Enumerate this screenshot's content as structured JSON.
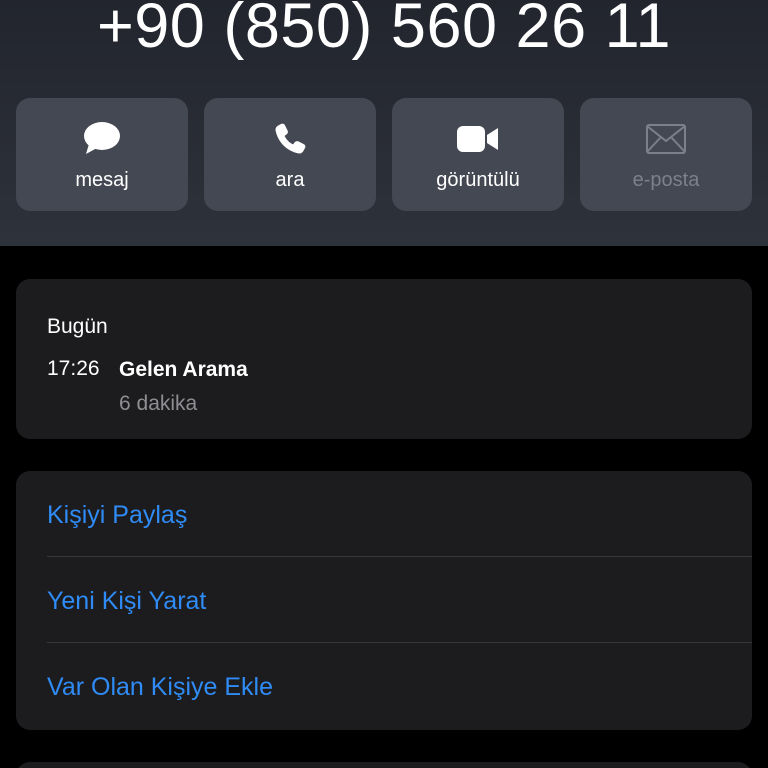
{
  "contact": {
    "phone_number": "+90 (850) 560 26 11"
  },
  "actions": [
    {
      "label": "mesaj",
      "icon": "message-bubble-icon",
      "enabled": true
    },
    {
      "label": "ara",
      "icon": "phone-icon",
      "enabled": true
    },
    {
      "label": "görüntülü",
      "icon": "video-camera-icon",
      "enabled": true
    },
    {
      "label": "e-posta",
      "icon": "envelope-icon",
      "enabled": false
    }
  ],
  "recents": {
    "date": "Bugün",
    "entries": [
      {
        "time": "17:26",
        "type": "Gelen Arama",
        "duration": "6 dakika"
      }
    ]
  },
  "contact_actions": [
    {
      "label": "Kişiyi Paylaş"
    },
    {
      "label": "Yeni Kişi Yarat"
    },
    {
      "label": "Var Olan Kişiye Ekle"
    }
  ],
  "colors": {
    "accent": "#2f8bf5",
    "button_bg": "#444852",
    "card_bg": "#1c1c1e",
    "secondary_text": "#8e8e93",
    "disabled_text": "#7c808a"
  }
}
